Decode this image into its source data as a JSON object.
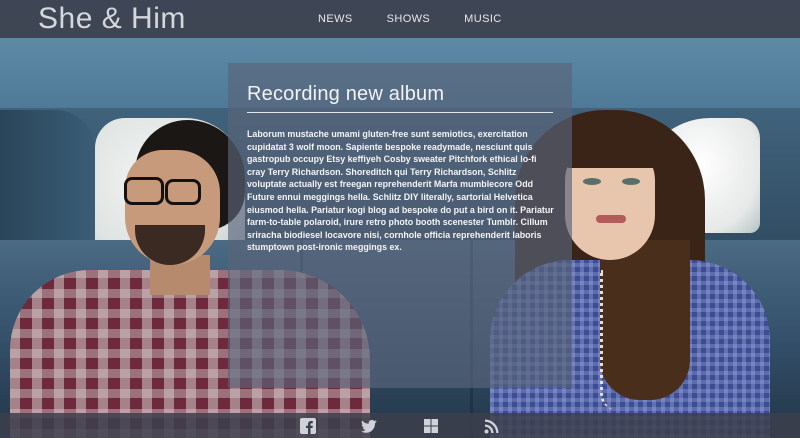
{
  "header": {
    "brand": "She & Him",
    "nav": [
      {
        "label": "NEWS"
      },
      {
        "label": "SHOWS"
      },
      {
        "label": "MUSIC"
      }
    ]
  },
  "post": {
    "title": "Recording new album",
    "body": "Laborum mustache umami gluten-free sunt semiotics, exercitation cupidatat 3 wolf moon. Sapiente bespoke readymade, nesciunt quis gastropub occupy Etsy keffiyeh Cosby sweater Pitchfork ethical lo-fi cray Terry Richardson. Shoreditch qui Terry Richardson, Schlitz voluptate actually est freegan reprehenderit Marfa mumblecore Odd Future ennui meggings hella. Schlitz DIY literally, sartorial Helvetica eiusmod hella. Pariatur kogi blog ad bespoke do put a bird on it. Pariatur farm-to-table polaroid, irure retro photo booth scenester Tumblr. Cillum sriracha biodiesel locavore nisi, cornhole officia reprehenderit laboris stumptown post-ironic meggings ex."
  },
  "footer": {
    "social_icons": [
      "facebook-icon",
      "twitter-icon",
      "windows-icon",
      "rss-icon"
    ]
  },
  "colors": {
    "topbar": "#3c404c",
    "panel": "#5a647a",
    "text": "#f1f3f5"
  }
}
